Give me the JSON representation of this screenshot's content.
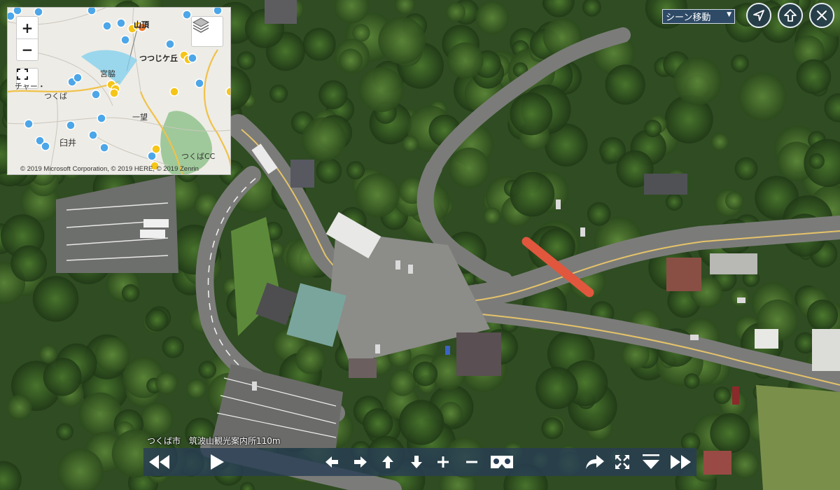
{
  "minimap": {
    "zoom_in_label": "+",
    "zoom_out_label": "−",
    "labels": {
      "summit": "山頂",
      "tsutsujigaoka": "つつじケ丘",
      "miyawaki": "宮脇",
      "tsukuba": "つくば",
      "center": "チャー・",
      "ichibo": "一望",
      "usui": "臼井",
      "tsukuba_cc": "つくばCC"
    },
    "copyright": "© 2019 Microsoft Corporation, © 2019 HERE, © 2019 Zenrin"
  },
  "header": {
    "scene_select": "シーン移動"
  },
  "location": {
    "label": "つくば市　筑波山観光案内所110m"
  },
  "toolbar": {
    "icons": [
      "rewind-icon",
      "play-icon",
      "pan-left-icon",
      "pan-right-icon",
      "pan-up-icon",
      "pan-down-icon",
      "zoom-in-icon",
      "zoom-out-icon",
      "vr-icon",
      "share-icon",
      "fullscreen-icon",
      "menu-icon",
      "fast-forward-icon"
    ]
  },
  "colors": {
    "map_marker_blue": "#4da6e8",
    "map_marker_yellow": "#f5c518",
    "map_marker_orange": "#f07a30",
    "bar_background": "#283e54",
    "torii_red": "#e0573e"
  }
}
